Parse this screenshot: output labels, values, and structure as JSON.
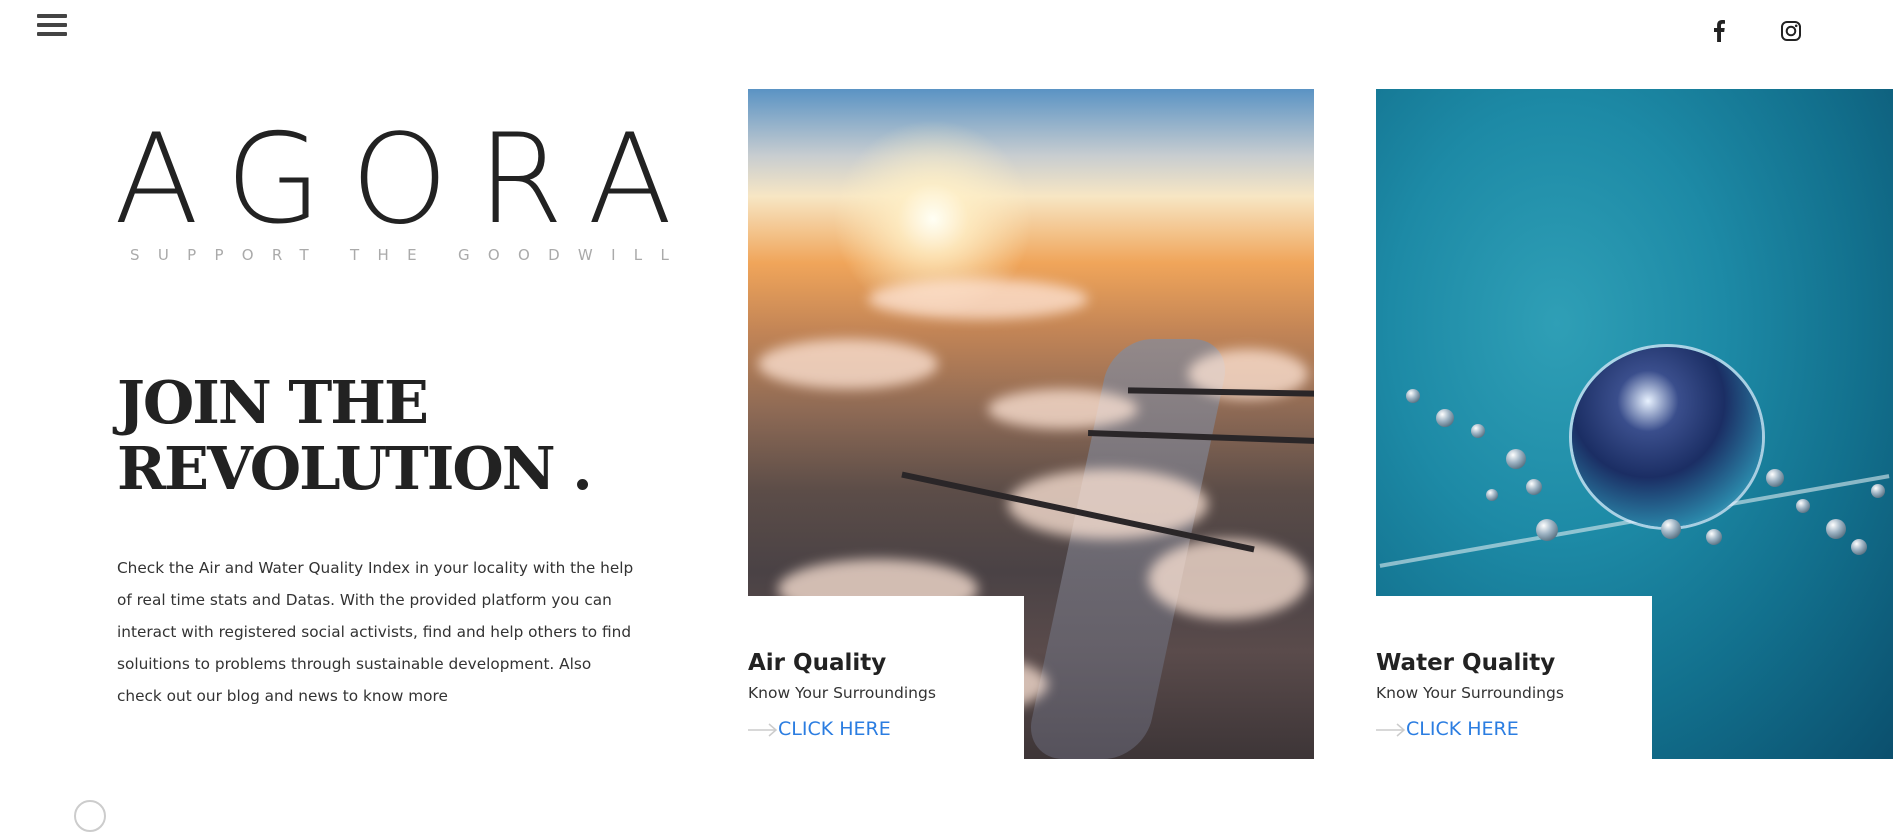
{
  "nav": {
    "menu_icon": "hamburger-menu-icon",
    "social": [
      {
        "name": "facebook-icon"
      },
      {
        "name": "instagram-icon"
      }
    ]
  },
  "brand": {
    "title": "AGORA",
    "tagline": "SUPPORT THE GOODWILL"
  },
  "hero": {
    "headline_line1": "JOIN THE",
    "headline_line2": "REVOLUTION .",
    "intro": "Check the Air and Water Quality Index in your locality with the help of real time stats and Datas. With the provided platform you can interact with registered social activists, find and help others to find soluitions to problems through sustainable development. Also check out our blog and news to know more"
  },
  "cards": [
    {
      "title": "Air Quality",
      "subtitle": "Know Your Surroundings",
      "link_label": "CLICK HERE"
    },
    {
      "title": "Water Quality",
      "subtitle": "Know Your Surroundings",
      "link_label": "CLICK HERE"
    }
  ],
  "colors": {
    "link": "#2b7de1",
    "text": "#222222",
    "tagline": "#aaaaaa"
  }
}
